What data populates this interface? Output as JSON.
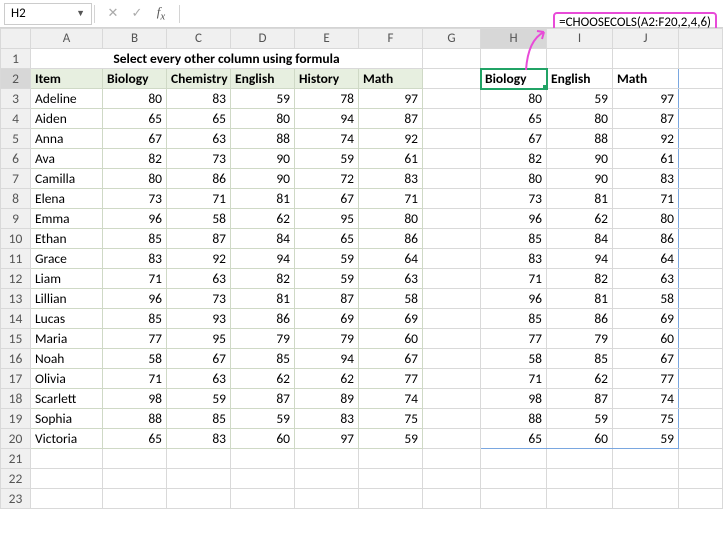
{
  "nameBox": "H2",
  "formula": "=CHOOSECOLS(A2:F20,2,4,6)",
  "columns": [
    "A",
    "B",
    "C",
    "D",
    "E",
    "F",
    "G",
    "H",
    "I",
    "J"
  ],
  "rows": [
    1,
    2,
    3,
    4,
    5,
    6,
    7,
    8,
    9,
    10,
    11,
    12,
    13,
    14,
    15,
    16,
    17,
    18,
    19,
    20,
    21,
    22,
    23
  ],
  "title": "Select every other column using formula",
  "headers": [
    "Item",
    "Biology",
    "Chemistry",
    "English",
    "History",
    "Math"
  ],
  "resultHeaders": [
    "Biology",
    "English",
    "Math"
  ],
  "data": [
    {
      "item": "Adeline",
      "v": [
        80,
        83,
        59,
        78,
        97
      ]
    },
    {
      "item": "Aiden",
      "v": [
        65,
        65,
        80,
        94,
        87
      ]
    },
    {
      "item": "Anna",
      "v": [
        67,
        63,
        88,
        74,
        92
      ]
    },
    {
      "item": "Ava",
      "v": [
        82,
        73,
        90,
        59,
        61
      ]
    },
    {
      "item": "Camilla",
      "v": [
        80,
        86,
        90,
        72,
        83
      ]
    },
    {
      "item": "Elena",
      "v": [
        73,
        71,
        81,
        67,
        71
      ]
    },
    {
      "item": "Emma",
      "v": [
        96,
        58,
        62,
        95,
        80
      ]
    },
    {
      "item": "Ethan",
      "v": [
        85,
        87,
        84,
        65,
        86
      ]
    },
    {
      "item": "Grace",
      "v": [
        83,
        92,
        94,
        59,
        64
      ]
    },
    {
      "item": "Liam",
      "v": [
        71,
        63,
        82,
        59,
        63
      ]
    },
    {
      "item": "Lillian",
      "v": [
        96,
        73,
        81,
        87,
        58
      ]
    },
    {
      "item": "Lucas",
      "v": [
        85,
        93,
        86,
        69,
        69
      ]
    },
    {
      "item": "Maria",
      "v": [
        77,
        95,
        79,
        79,
        60
      ]
    },
    {
      "item": "Noah",
      "v": [
        58,
        67,
        85,
        94,
        67
      ]
    },
    {
      "item": "Olivia",
      "v": [
        71,
        63,
        62,
        62,
        77
      ]
    },
    {
      "item": "Scarlett",
      "v": [
        98,
        59,
        87,
        89,
        74
      ]
    },
    {
      "item": "Sophia",
      "v": [
        88,
        85,
        59,
        83,
        75
      ]
    },
    {
      "item": "Victoria",
      "v": [
        65,
        83,
        60,
        97,
        59
      ]
    }
  ],
  "chart_data": {
    "type": "table",
    "title": "Select every other column using formula",
    "columns": [
      "Item",
      "Biology",
      "Chemistry",
      "English",
      "History",
      "Math"
    ],
    "rows": [
      [
        "Adeline",
        80,
        83,
        59,
        78,
        97
      ],
      [
        "Aiden",
        65,
        65,
        80,
        94,
        87
      ],
      [
        "Anna",
        67,
        63,
        88,
        74,
        92
      ],
      [
        "Ava",
        82,
        73,
        90,
        59,
        61
      ],
      [
        "Camilla",
        80,
        86,
        90,
        72,
        83
      ],
      [
        "Elena",
        73,
        71,
        81,
        67,
        71
      ],
      [
        "Emma",
        96,
        58,
        62,
        95,
        80
      ],
      [
        "Ethan",
        85,
        87,
        84,
        65,
        86
      ],
      [
        "Grace",
        83,
        92,
        94,
        59,
        64
      ],
      [
        "Liam",
        71,
        63,
        82,
        59,
        63
      ],
      [
        "Lillian",
        96,
        73,
        81,
        87,
        58
      ],
      [
        "Lucas",
        85,
        93,
        86,
        69,
        69
      ],
      [
        "Maria",
        77,
        95,
        79,
        79,
        60
      ],
      [
        "Noah",
        58,
        67,
        85,
        94,
        67
      ],
      [
        "Olivia",
        71,
        63,
        62,
        62,
        77
      ],
      [
        "Scarlett",
        98,
        59,
        87,
        89,
        74
      ],
      [
        "Sophia",
        88,
        85,
        59,
        83,
        75
      ],
      [
        "Victoria",
        65,
        83,
        60,
        97,
        59
      ]
    ],
    "result_columns": [
      "Biology",
      "English",
      "Math"
    ],
    "result_formula": "=CHOOSECOLS(A2:F20,2,4,6)"
  }
}
